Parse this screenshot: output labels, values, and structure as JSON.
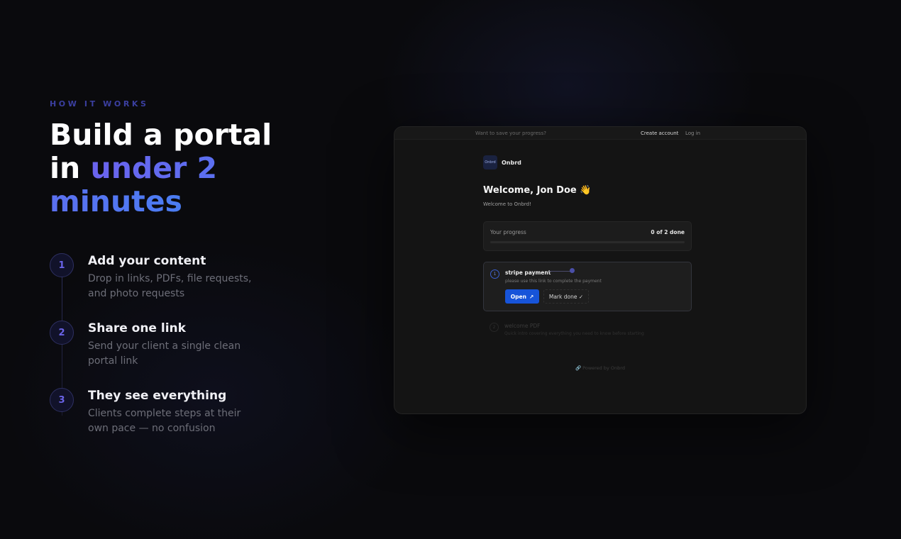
{
  "intro": {
    "eyebrow": "HOW IT WORKS",
    "headline_plain": "Build a portal in ",
    "headline_accent": "under 2 minutes"
  },
  "steps": [
    {
      "number": "1",
      "title": "Add your content",
      "description": "Drop in links, PDFs, file requests, and photo requests"
    },
    {
      "number": "2",
      "title": "Share one link",
      "description": "Send your client a single clean portal link"
    },
    {
      "number": "3",
      "title": "They see everything",
      "description": "Clients complete steps at their own pace — no confusion"
    }
  ],
  "mockup": {
    "topbar": {
      "save_prompt": "Want to save your progress?",
      "create_account": "Create account",
      "login": "Log in"
    },
    "brand": {
      "logo_text": "Onbrd",
      "name": "Onbrd"
    },
    "welcome_title": "Welcome, Jon Doe 👋",
    "welcome_subtitle": "Welcome to Onbrd!",
    "progress": {
      "label": "Your progress",
      "count": "0 of 2 done",
      "fraction": 0
    },
    "task_active": {
      "number": "1",
      "title": "stripe payment",
      "description": "please use this link to complete the payment",
      "open_label": "Open",
      "open_icon": "↗",
      "done_label": "Mark done ✓"
    },
    "task_next": {
      "number": "2",
      "title": "welcome PDF",
      "description": "Quick intro covering everything you need to know before starting"
    },
    "powered_by": "🔗 Powered by Onbrd"
  },
  "colors": {
    "accent_start": "#6b63ee",
    "accent_end": "#4a7df2",
    "button_blue": "#1754d9"
  }
}
